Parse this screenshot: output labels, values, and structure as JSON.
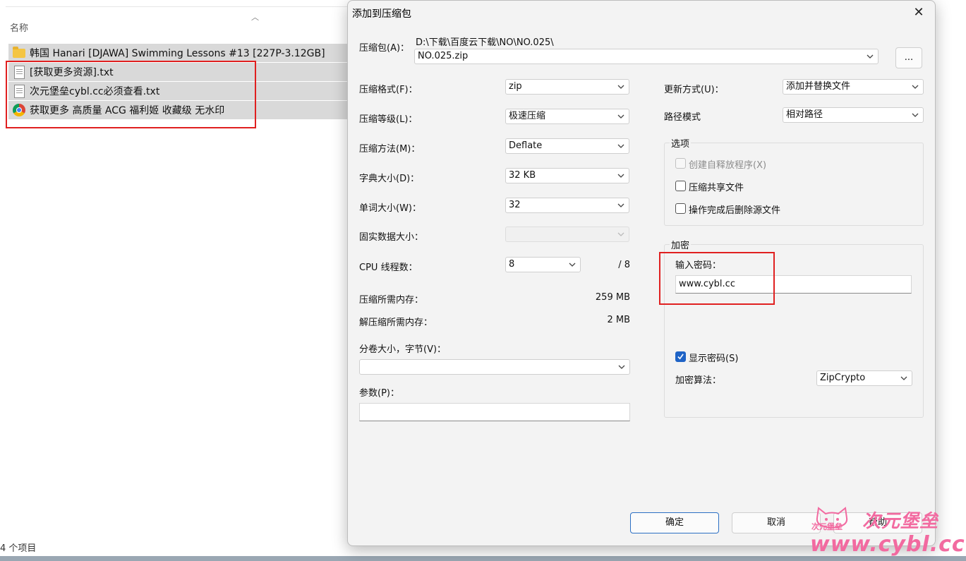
{
  "explorer": {
    "column_name": "名称",
    "files": [
      {
        "name": "韩国 Hanari [DJAWA] Swimming Lessons #13 [227P-3.12GB]",
        "icon": "folder-icon"
      },
      {
        "name": "[获取更多资源].txt",
        "icon": "text-file-icon"
      },
      {
        "name": "次元堡垒cybl.cc必须查看.txt",
        "icon": "text-file-icon"
      },
      {
        "name": "获取更多 高质量 ACG 福利姬 收藏级 无水印",
        "icon": "chrome-shortcut-icon"
      }
    ],
    "status": "4 个项目"
  },
  "dialog": {
    "title": "添加到压缩包",
    "archive_label": "压缩包(A)：",
    "archive_path": "D:\\下载\\百度云下载\\NO\\NO.025\\",
    "archive_name": "NO.025.zip",
    "browse_label": "...",
    "format_label": "压缩格式(F)：",
    "format_value": "zip",
    "level_label": "压缩等级(L)：",
    "level_value": "极速压缩",
    "method_label": "压缩方法(M)：",
    "method_value": "Deflate",
    "dict_label": "字典大小(D)：",
    "dict_value": "32 KB",
    "word_label": "单词大小(W)：",
    "word_value": "32",
    "solid_label": "固实数据大小：",
    "solid_value": "",
    "cpu_label": "CPU 线程数：",
    "cpu_value": "8",
    "cpu_max": "/ 8",
    "mem_comp_label": "压缩所需内存：",
    "mem_comp_value": "259 MB",
    "mem_decomp_label": "解压缩所需内存：",
    "mem_decomp_value": "2 MB",
    "volume_label": "分卷大小，字节(V)：",
    "volume_value": "",
    "params_label": "参数(P)：",
    "params_value": "",
    "update_label": "更新方式(U)：",
    "update_value": "添加并替换文件",
    "path_label": "路径模式",
    "path_value": "相对路径",
    "options_title": "选项",
    "options": [
      {
        "label": "创建自释放程序(X)",
        "checked": false,
        "disabled": true
      },
      {
        "label": "压缩共享文件",
        "checked": false,
        "disabled": false
      },
      {
        "label": "操作完成后删除源文件",
        "checked": false,
        "disabled": false
      }
    ],
    "encryption_title": "加密",
    "password_label": "输入密码：",
    "password_value": "www.cybl.cc",
    "show_password_label": "显示密码(S)",
    "show_password_checked": true,
    "enc_method_label": "加密算法：",
    "enc_method_value": "ZipCrypto",
    "ok_label": "确定",
    "cancel_label": "取消",
    "help_label": "帮助"
  },
  "watermark": {
    "small_text": "次元堡垒",
    "big_text": "次元堡垒",
    "url": "www.cybl.cc"
  },
  "colors": {
    "accent": "#1f63c6",
    "highlight_box": "#e02020",
    "watermark": "#f26aa0",
    "selection": "#d9d9d9"
  }
}
